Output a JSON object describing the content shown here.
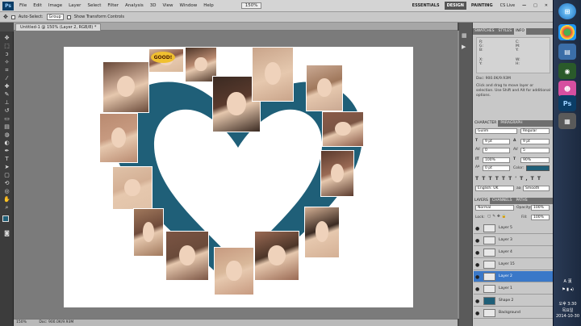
{
  "menubar": {
    "logo": "Ps",
    "items": [
      "File",
      "Edit",
      "Image",
      "Layer",
      "Select",
      "Filter",
      "Analysis",
      "3D",
      "View",
      "Window",
      "Help"
    ],
    "zoom": "150%",
    "workspaces": [
      "ESSENTIALS",
      "DESIGN",
      "PAINTING"
    ],
    "cslive": "CS Live"
  },
  "options": {
    "auto_select_label": "Auto-Select:",
    "auto_select_value": "Group",
    "transform_label": "Show Transform Controls"
  },
  "doc_tab": "Untitled-1 @ 150% (Layer 2, RGB/8) *",
  "status": {
    "zoom": "150%",
    "doc": "Doc: 900.0K/9.93M"
  },
  "colors": {
    "heart": "#1f5f78",
    "selected_layer": "#3a78c8"
  },
  "info_panel": {
    "tabs": [
      "SWATCHES",
      "STYLES",
      "INFO"
    ],
    "doc": "Doc: 900.0K/9.93M",
    "hint": "Click and drag to move layer or selection. Use Shift and Alt for additional options."
  },
  "character_panel": {
    "tabs": [
      "CHARACTER",
      "PARAGRAPH"
    ],
    "font": "Gulim",
    "style": "Regular",
    "size": "9 pt",
    "leading": "9 pt",
    "tracking": "0",
    "kerning": "5",
    "vscale": "100%",
    "hscale": "90%",
    "baseline": "0 pt",
    "color_label": "Color:",
    "language": "English: UK",
    "aa_label": "aa",
    "antialias": "Smooth"
  },
  "layers_panel": {
    "tabs": [
      "LAYERS",
      "CHANNELS",
      "PATHS"
    ],
    "blend": "Normal",
    "opacity_label": "Opacity:",
    "opacity": "100%",
    "lock_label": "Lock:",
    "fill_label": "Fill:",
    "fill": "100%",
    "layers": [
      {
        "name": "Layer 5",
        "selected": false
      },
      {
        "name": "Layer 3",
        "selected": false
      },
      {
        "name": "Layer 4",
        "selected": false
      },
      {
        "name": "Layer 15",
        "selected": false
      },
      {
        "name": "Layer 2",
        "selected": true
      },
      {
        "name": "Layer 1",
        "selected": false
      },
      {
        "name": "Shape 2",
        "selected": false
      },
      {
        "name": "Background",
        "selected": false
      }
    ]
  },
  "canvas": {
    "sticker_text": "GOOD!",
    "photo_tones": [
      "#6a4a3a",
      "#d9b89a",
      "#4c3528",
      "#3a2a22",
      "#c9a48a",
      "#caa993",
      "#8a5a48",
      "#b98a70",
      "#5a3a2d",
      "#e0c2a8",
      "#a0785c",
      "#7b5544",
      "#c79a80",
      "#9a6a54",
      "#d4b095",
      "#6e4a3a"
    ]
  },
  "taskbar": {
    "lang": "A 漢",
    "time": "오후 3:30",
    "day": "목요일",
    "date": "2014-10-30"
  }
}
